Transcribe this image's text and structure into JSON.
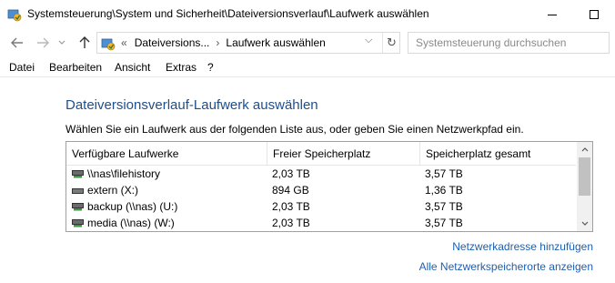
{
  "window": {
    "title": "Systemsteuerung\\System und Sicherheit\\Dateiversionsverlauf\\Laufwerk auswählen"
  },
  "navigation": {
    "back_icon": "arrow-left-icon",
    "forward_icon": "arrow-right-icon",
    "recent_icon": "chevron-down-icon",
    "up_icon": "arrow-up-icon"
  },
  "address": {
    "overflow": "«",
    "crumbs": [
      "Dateiversions...",
      "Laufwerk auswählen"
    ],
    "separator": "›",
    "dropdown": "⌵",
    "refresh": "↻"
  },
  "search": {
    "placeholder": "Systemsteuerung durchsuchen"
  },
  "menu": [
    "Datei",
    "Bearbeiten",
    "Ansicht",
    "Extras",
    "?"
  ],
  "content": {
    "heading": "Dateiversionsverlauf-Laufwerk auswählen",
    "instruction": "Wählen Sie ein Laufwerk aus der folgenden Liste aus, oder geben Sie einen Netzwerkpfad ein."
  },
  "drives": {
    "columns": [
      "Verfügbare Laufwerke",
      "Freier Speicherplatz",
      "Speicherplatz gesamt"
    ],
    "rows": [
      {
        "name": "\\\\nas\\filehistory",
        "free": "2,03 TB",
        "total": "3,57 TB",
        "icon": "network-drive-icon"
      },
      {
        "name": "extern (X:)",
        "free": "894 GB",
        "total": "1,36 TB",
        "icon": "drive-icon"
      },
      {
        "name": "backup (\\\\nas) (U:)",
        "free": "2,03 TB",
        "total": "3,57 TB",
        "icon": "network-drive-icon"
      },
      {
        "name": "media (\\\\nas) (W:)",
        "free": "2,03 TB",
        "total": "3,57 TB",
        "icon": "network-drive-icon"
      }
    ]
  },
  "links": {
    "add_network": "Netzwerkadresse hinzufügen",
    "show_all": "Alle Netzwerkspeicherorte anzeigen"
  },
  "colors": {
    "heading": "#1e4e8c",
    "link": "#1a5fb4"
  }
}
